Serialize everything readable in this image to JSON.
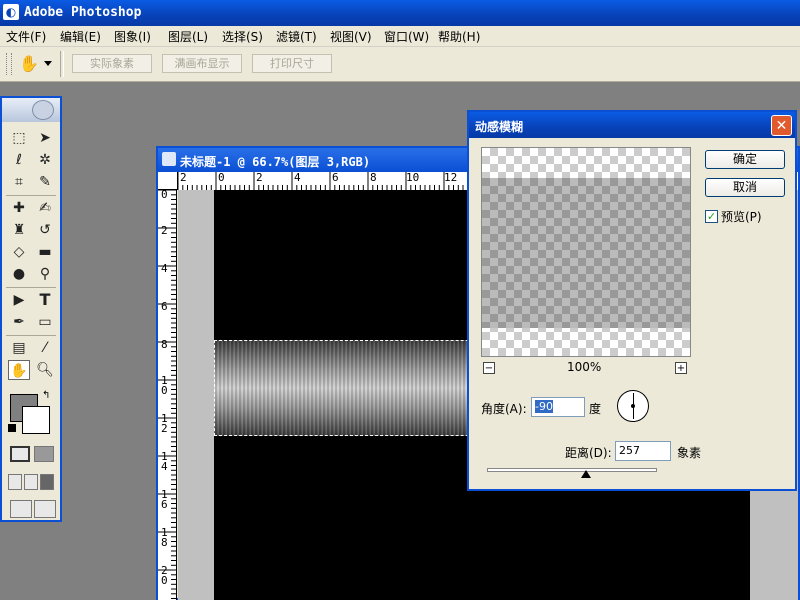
{
  "app": {
    "title": "Adobe Photoshop"
  },
  "menu": [
    "文件(F)",
    "编辑(E)",
    "图象(I)",
    "图层(L)",
    "选择(S)",
    "滤镜(T)",
    "视图(V)",
    "窗口(W)",
    "帮助(H)"
  ],
  "options": {
    "actual_pixels": "实际象素",
    "fit_screen": "满画布显示",
    "print_size": "打印尺寸"
  },
  "toolbox": {
    "icons": [
      "marquee-icon",
      "move-icon",
      "lasso-icon",
      "magic-wand-icon",
      "crop-icon",
      "slice-icon",
      "healing-brush-icon",
      "brush-icon",
      "clone-stamp-icon",
      "history-brush-icon",
      "eraser-icon",
      "gradient-icon",
      "blur-icon",
      "dodge-icon",
      "path-selection-icon",
      "type-icon",
      "pen-icon",
      "shape-icon",
      "notes-icon",
      "eyedropper-icon",
      "hand-icon",
      "zoom-icon"
    ],
    "foreground_color": "#808080",
    "background_color": "#ffffff"
  },
  "document": {
    "title": "未标题-1 @ 66.7%(图层 3,RGB)",
    "hruler": [
      "2",
      "0",
      "2",
      "4",
      "6",
      "8",
      "10",
      "12"
    ],
    "vruler": [
      "0",
      "2",
      "4",
      "6",
      "8",
      "1\n0",
      "1\n2",
      "1\n4",
      "1\n6",
      "1\n8",
      "2\n0"
    ]
  },
  "dialog": {
    "title": "动感模糊",
    "ok": "确定",
    "cancel": "取消",
    "preview_label": "预览(P)",
    "preview_checked": true,
    "zoom": "100%",
    "zoom_out": "−",
    "zoom_in": "+",
    "angle_label": "角度(A):",
    "angle_value": "-90",
    "angle_unit": "度",
    "distance_label": "距离(D):",
    "distance_value": "257",
    "distance_unit": "象素"
  }
}
